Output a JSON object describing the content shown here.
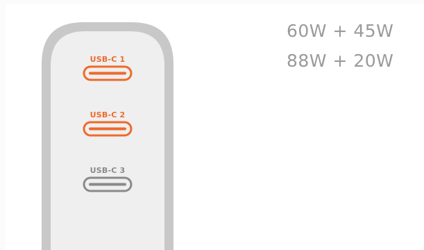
{
  "colors": {
    "active_port": "#ed6a2c",
    "inactive_port": "#8a8a8a",
    "body": "#efefef",
    "shell": "#c8c8c8",
    "text": "#9a9a9a"
  },
  "ports": [
    {
      "label": "USB-C 1",
      "active": true
    },
    {
      "label": "USB-C 2",
      "active": true
    },
    {
      "label": "USB-C 3",
      "active": false
    }
  ],
  "power_specs": [
    "60W + 45W",
    "88W + 20W"
  ]
}
